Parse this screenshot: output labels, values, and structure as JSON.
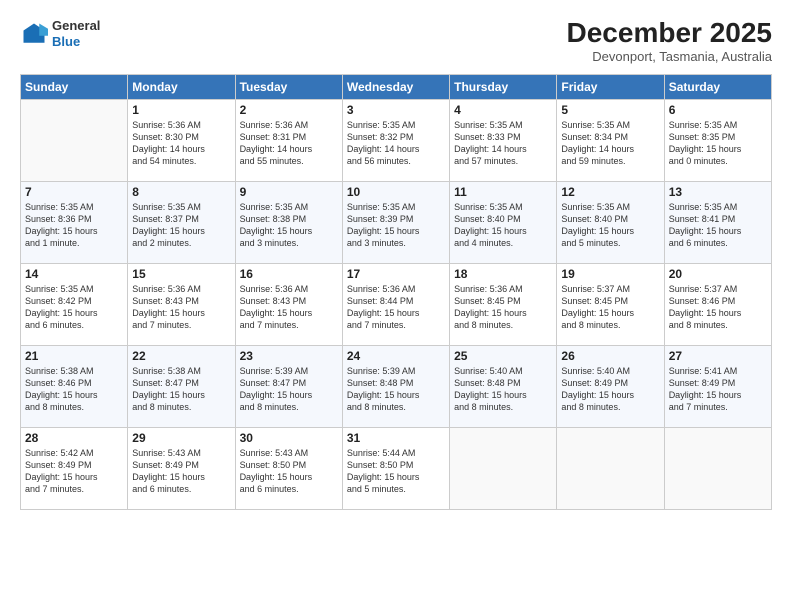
{
  "header": {
    "logo_general": "General",
    "logo_blue": "Blue",
    "month_title": "December 2025",
    "subtitle": "Devonport, Tasmania, Australia"
  },
  "days_of_week": [
    "Sunday",
    "Monday",
    "Tuesday",
    "Wednesday",
    "Thursday",
    "Friday",
    "Saturday"
  ],
  "weeks": [
    [
      {
        "day": "",
        "info": ""
      },
      {
        "day": "1",
        "info": "Sunrise: 5:36 AM\nSunset: 8:30 PM\nDaylight: 14 hours\nand 54 minutes."
      },
      {
        "day": "2",
        "info": "Sunrise: 5:36 AM\nSunset: 8:31 PM\nDaylight: 14 hours\nand 55 minutes."
      },
      {
        "day": "3",
        "info": "Sunrise: 5:35 AM\nSunset: 8:32 PM\nDaylight: 14 hours\nand 56 minutes."
      },
      {
        "day": "4",
        "info": "Sunrise: 5:35 AM\nSunset: 8:33 PM\nDaylight: 14 hours\nand 57 minutes."
      },
      {
        "day": "5",
        "info": "Sunrise: 5:35 AM\nSunset: 8:34 PM\nDaylight: 14 hours\nand 59 minutes."
      },
      {
        "day": "6",
        "info": "Sunrise: 5:35 AM\nSunset: 8:35 PM\nDaylight: 15 hours\nand 0 minutes."
      }
    ],
    [
      {
        "day": "7",
        "info": "Sunrise: 5:35 AM\nSunset: 8:36 PM\nDaylight: 15 hours\nand 1 minute."
      },
      {
        "day": "8",
        "info": "Sunrise: 5:35 AM\nSunset: 8:37 PM\nDaylight: 15 hours\nand 2 minutes."
      },
      {
        "day": "9",
        "info": "Sunrise: 5:35 AM\nSunset: 8:38 PM\nDaylight: 15 hours\nand 3 minutes."
      },
      {
        "day": "10",
        "info": "Sunrise: 5:35 AM\nSunset: 8:39 PM\nDaylight: 15 hours\nand 3 minutes."
      },
      {
        "day": "11",
        "info": "Sunrise: 5:35 AM\nSunset: 8:40 PM\nDaylight: 15 hours\nand 4 minutes."
      },
      {
        "day": "12",
        "info": "Sunrise: 5:35 AM\nSunset: 8:40 PM\nDaylight: 15 hours\nand 5 minutes."
      },
      {
        "day": "13",
        "info": "Sunrise: 5:35 AM\nSunset: 8:41 PM\nDaylight: 15 hours\nand 6 minutes."
      }
    ],
    [
      {
        "day": "14",
        "info": "Sunrise: 5:35 AM\nSunset: 8:42 PM\nDaylight: 15 hours\nand 6 minutes."
      },
      {
        "day": "15",
        "info": "Sunrise: 5:36 AM\nSunset: 8:43 PM\nDaylight: 15 hours\nand 7 minutes."
      },
      {
        "day": "16",
        "info": "Sunrise: 5:36 AM\nSunset: 8:43 PM\nDaylight: 15 hours\nand 7 minutes."
      },
      {
        "day": "17",
        "info": "Sunrise: 5:36 AM\nSunset: 8:44 PM\nDaylight: 15 hours\nand 7 minutes."
      },
      {
        "day": "18",
        "info": "Sunrise: 5:36 AM\nSunset: 8:45 PM\nDaylight: 15 hours\nand 8 minutes."
      },
      {
        "day": "19",
        "info": "Sunrise: 5:37 AM\nSunset: 8:45 PM\nDaylight: 15 hours\nand 8 minutes."
      },
      {
        "day": "20",
        "info": "Sunrise: 5:37 AM\nSunset: 8:46 PM\nDaylight: 15 hours\nand 8 minutes."
      }
    ],
    [
      {
        "day": "21",
        "info": "Sunrise: 5:38 AM\nSunset: 8:46 PM\nDaylight: 15 hours\nand 8 minutes."
      },
      {
        "day": "22",
        "info": "Sunrise: 5:38 AM\nSunset: 8:47 PM\nDaylight: 15 hours\nand 8 minutes."
      },
      {
        "day": "23",
        "info": "Sunrise: 5:39 AM\nSunset: 8:47 PM\nDaylight: 15 hours\nand 8 minutes."
      },
      {
        "day": "24",
        "info": "Sunrise: 5:39 AM\nSunset: 8:48 PM\nDaylight: 15 hours\nand 8 minutes."
      },
      {
        "day": "25",
        "info": "Sunrise: 5:40 AM\nSunset: 8:48 PM\nDaylight: 15 hours\nand 8 minutes."
      },
      {
        "day": "26",
        "info": "Sunrise: 5:40 AM\nSunset: 8:49 PM\nDaylight: 15 hours\nand 8 minutes."
      },
      {
        "day": "27",
        "info": "Sunrise: 5:41 AM\nSunset: 8:49 PM\nDaylight: 15 hours\nand 7 minutes."
      }
    ],
    [
      {
        "day": "28",
        "info": "Sunrise: 5:42 AM\nSunset: 8:49 PM\nDaylight: 15 hours\nand 7 minutes."
      },
      {
        "day": "29",
        "info": "Sunrise: 5:43 AM\nSunset: 8:49 PM\nDaylight: 15 hours\nand 6 minutes."
      },
      {
        "day": "30",
        "info": "Sunrise: 5:43 AM\nSunset: 8:50 PM\nDaylight: 15 hours\nand 6 minutes."
      },
      {
        "day": "31",
        "info": "Sunrise: 5:44 AM\nSunset: 8:50 PM\nDaylight: 15 hours\nand 5 minutes."
      },
      {
        "day": "",
        "info": ""
      },
      {
        "day": "",
        "info": ""
      },
      {
        "day": "",
        "info": ""
      }
    ]
  ]
}
